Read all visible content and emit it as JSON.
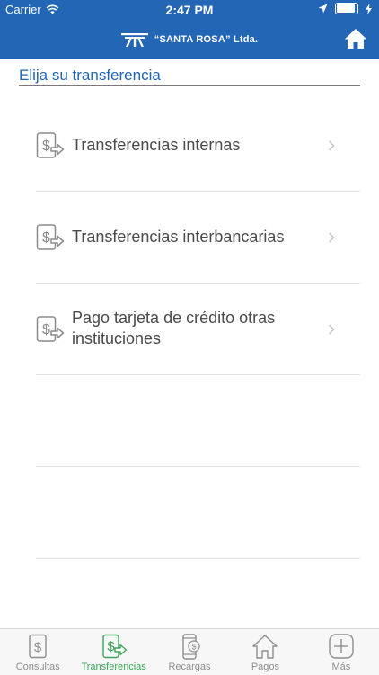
{
  "status_bar": {
    "carrier": "Carrier",
    "time": "2:47 PM"
  },
  "header": {
    "brand_name": "“SANTA ROSA” Ltda."
  },
  "section_title": "Elija su transferencia",
  "list": {
    "items": [
      {
        "label": "Transferencias internas"
      },
      {
        "label": "Transferencias interbancarias"
      },
      {
        "label": "Pago tarjeta de crédito otras instituciones"
      }
    ]
  },
  "tabbar": {
    "tabs": [
      {
        "label": "Consultas",
        "icon": "dollar-document-icon"
      },
      {
        "label": "Transferencias",
        "icon": "dollar-transfer-icon"
      },
      {
        "label": "Recargas",
        "icon": "phone-icon"
      },
      {
        "label": "Pagos",
        "icon": "home-icon"
      },
      {
        "label": "Más",
        "icon": "plus-icon"
      }
    ],
    "active_color": "#3aa659",
    "inactive_color": "#8e8e8e"
  },
  "colors": {
    "primary": "#2266b5",
    "battery_level": 0.9
  }
}
